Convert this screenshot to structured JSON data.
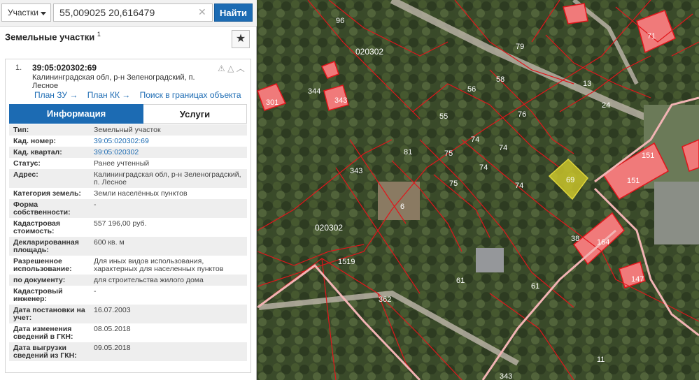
{
  "search": {
    "type_label": "Участки",
    "query": "55,009025 20,616479",
    "button_label": "Найти"
  },
  "panel": {
    "title": "Земельные участки",
    "count": "1"
  },
  "card": {
    "index": "1.",
    "cad_number": "39:05:020302:69",
    "address": "Калининградская обл, р-н Зеленоградский, п. Лесное",
    "links": {
      "plan_zu": "План ЗУ →",
      "plan_kk": "План КК →",
      "search_in_bounds": "Поиск в границах объекта →"
    }
  },
  "tabs": {
    "info": "Информация",
    "services": "Услуги"
  },
  "info_rows": [
    {
      "k": "Тип:",
      "v": "Земельный участок"
    },
    {
      "k": "Кад. номер:",
      "v": "39:05:020302:69",
      "link": true
    },
    {
      "k": "Кад. квартал:",
      "v": "39:05:020302",
      "link": true
    },
    {
      "k": "Статус:",
      "v": "Ранее учтенный"
    },
    {
      "k": "Адрес:",
      "v": "Калининградская обл, р-н Зеленоградский, п. Лесное"
    },
    {
      "k": "Категория земель:",
      "v": "Земли населённых пунктов"
    },
    {
      "k": "Форма собственности:",
      "v": "-"
    },
    {
      "k": "Кадастровая стоимость:",
      "v": "557 196,00 руб."
    },
    {
      "k": "Декларированная площадь:",
      "v": "600 кв. м"
    },
    {
      "k": "Разрешенное использование:",
      "v": "Для иных видов использования, характерных для населенных пунктов"
    },
    {
      "k": "по документу:",
      "v": "для строительства жилого дома"
    },
    {
      "k": "Кадастровый инженер:",
      "v": "-"
    },
    {
      "k": "Дата постановки на учет:",
      "v": "16.07.2003"
    },
    {
      "k": "Дата изменения сведений в ГКН:",
      "v": "08.05.2018"
    },
    {
      "k": "Дата выгрузки сведений из ГКН:",
      "v": "09.05.2018"
    }
  ],
  "map": {
    "quarter_labels": [
      "020302",
      "020302"
    ],
    "parcel_labels": [
      "96",
      "71",
      "79",
      "344",
      "301",
      "343",
      "56",
      "58",
      "13",
      "55",
      "76",
      "24",
      "74",
      "74",
      "74",
      "75",
      "75",
      "81",
      "343",
      "69",
      "151",
      "151",
      "6",
      "74",
      "38",
      "164",
      "1519",
      "61",
      "61",
      "147",
      "362",
      "11",
      "343"
    ],
    "selected_parcel": "69",
    "colors": {
      "boundary": "#e0161b",
      "building": "#f07a7a",
      "selected": "#c9c32a"
    }
  }
}
